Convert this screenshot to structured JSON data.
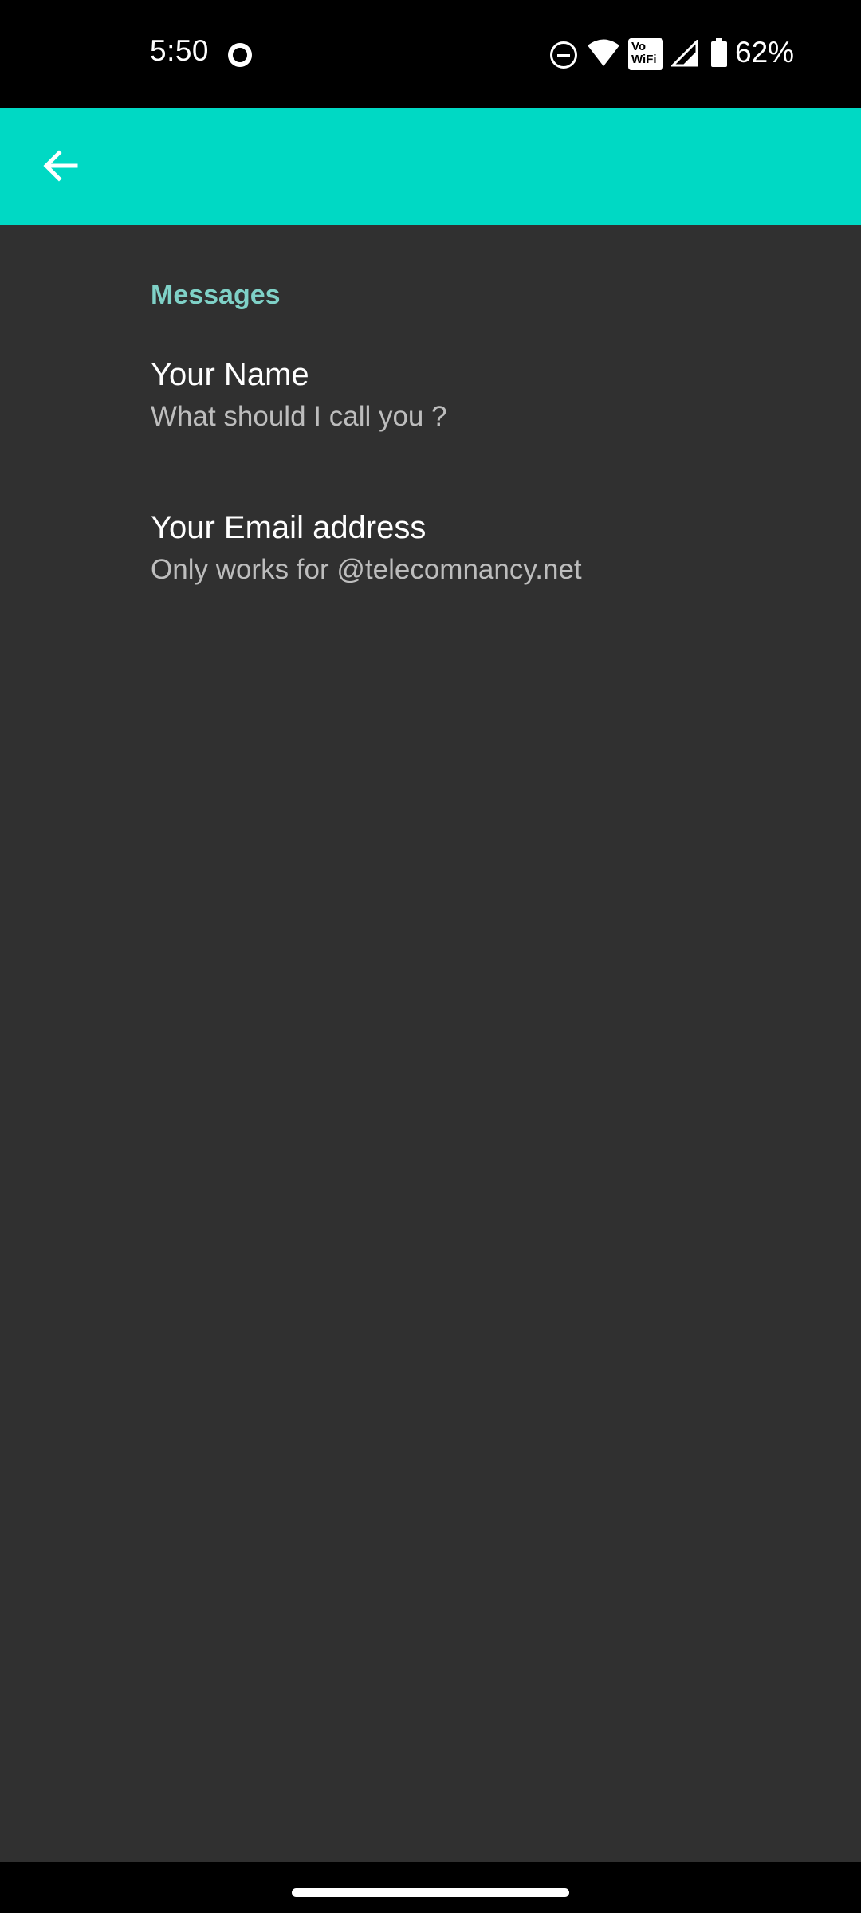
{
  "status_bar": {
    "time": "5:50",
    "battery_level": "62%",
    "vowifi_label_top": "Vo",
    "vowifi_label_bottom": "WiFi",
    "icons": [
      "record-icon",
      "do-not-disturb-icon",
      "wifi-icon",
      "vowifi-icon",
      "signal-icon",
      "battery-icon"
    ]
  },
  "toolbar": {
    "back_icon": "arrow-left-icon",
    "color": "#00d9c4"
  },
  "settings": {
    "section_header": "Messages",
    "items": [
      {
        "title": "Your Name",
        "summary": "What should I call you ?"
      },
      {
        "title": "Your Email address",
        "summary": "Only works for @telecomnancy.net"
      }
    ]
  },
  "colors": {
    "background": "#303030",
    "accent": "#7fd1c7",
    "title_text": "#ffffff",
    "summary_text": "#bdbdbd"
  }
}
